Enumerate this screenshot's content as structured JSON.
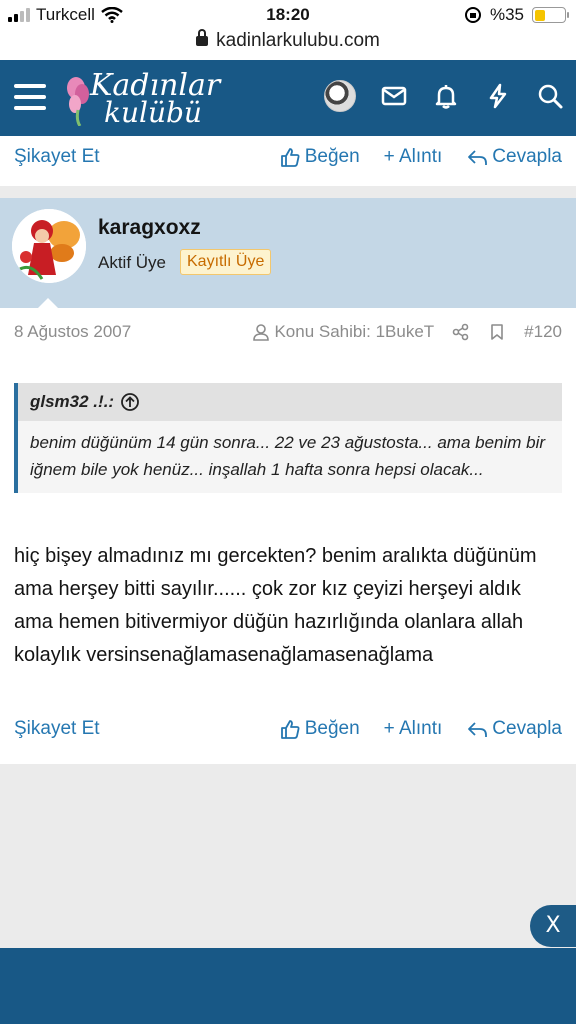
{
  "status_bar": {
    "carrier": "Turkcell",
    "time": "18:20",
    "battery_percent": "%35",
    "battery_level": 0.35
  },
  "browser": {
    "url": "kadinlarkulubu.com"
  },
  "header": {
    "logo_line1": "Kadınlar",
    "logo_line2": "kulübü",
    "icons": [
      "menu-icon",
      "avatar",
      "envelope-icon",
      "bell-icon",
      "bolt-icon",
      "search-icon"
    ],
    "bar_color": "#185886"
  },
  "top_actions": {
    "report": "Şikayet Et",
    "like": "Beğen",
    "quote": "+ Alıntı",
    "reply": "Cevapla"
  },
  "post": {
    "username": "karagxoxz",
    "user_title": "Aktif Üye",
    "badge": "Kayıtlı Üye",
    "date": "8 Ağustos 2007",
    "thread_starter": "Konu Sahibi: 1BukeT",
    "post_number": "#120",
    "quote": {
      "author": "glsm32 .!.:",
      "text": "benim düğünüm 14 gün sonra... 22 ve 23 ağustosta... ama benim bir iğnem bile yok henüz... inşallah 1 hafta sonra hepsi olacak..."
    },
    "message": "hiç bişey almadınız mı gercekten? benim aralıkta düğünüm ama herşey bitti sayılır...... çok zor kız çeyizi herşeyi aldık ama hemen bitivermiyor düğün hazırlığında olanlara allah kolaylık versinsenağlamasenağlamasenağlama",
    "actions": {
      "report": "Şikayet Et",
      "like": "Beğen",
      "quote": "+ Alıntı",
      "reply": "Cevapla"
    }
  },
  "close_button": "X",
  "colors": {
    "accent": "#2577b1",
    "user_block": "#c4d7e6"
  }
}
